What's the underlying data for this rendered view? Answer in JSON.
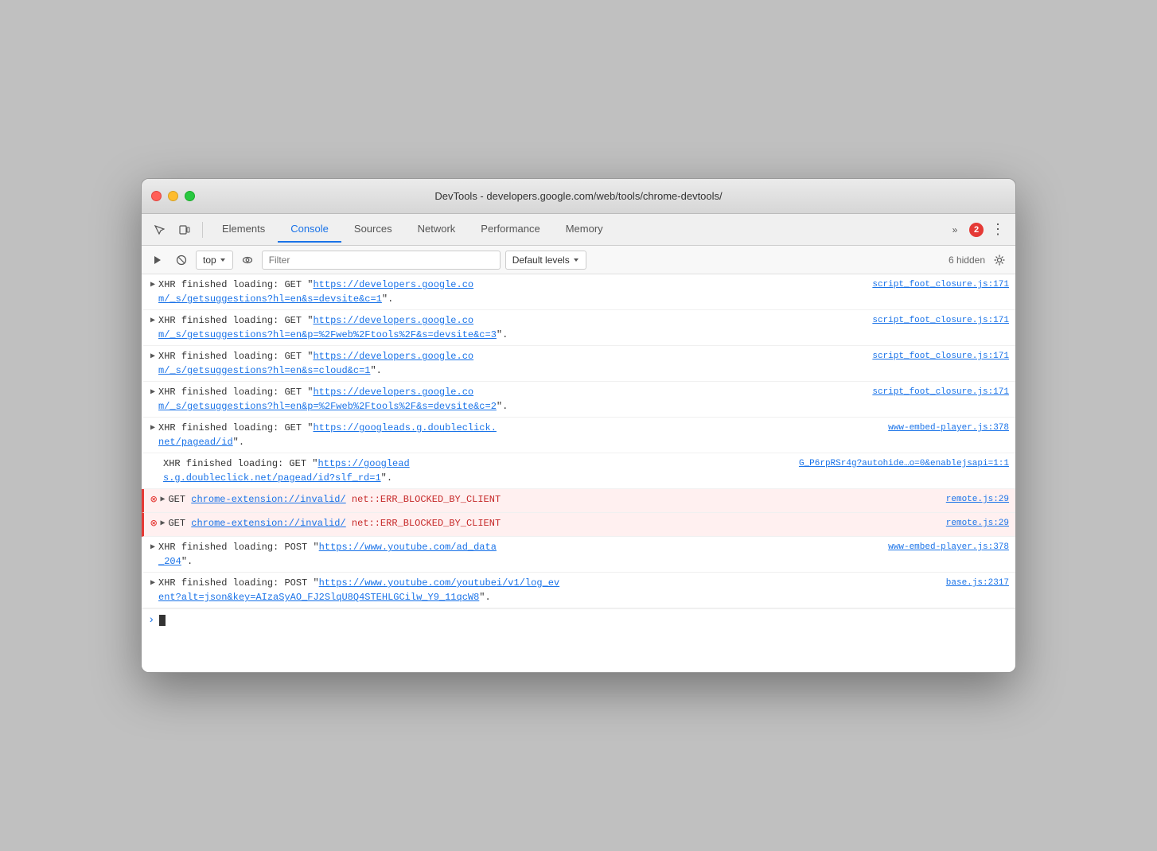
{
  "window": {
    "title": "DevTools - developers.google.com/web/tools/chrome-devtools/"
  },
  "toolbar": {
    "tabs": [
      {
        "id": "elements",
        "label": "Elements",
        "active": false
      },
      {
        "id": "console",
        "label": "Console",
        "active": true
      },
      {
        "id": "sources",
        "label": "Sources",
        "active": false
      },
      {
        "id": "network",
        "label": "Network",
        "active": false
      },
      {
        "id": "performance",
        "label": "Performance",
        "active": false
      },
      {
        "id": "memory",
        "label": "Memory",
        "active": false
      }
    ],
    "error_count": "2",
    "more_label": "»"
  },
  "console_toolbar": {
    "context": "top",
    "filter_placeholder": "Filter",
    "levels_label": "Default levels",
    "hidden_count": "6 hidden"
  },
  "entries": [
    {
      "type": "normal",
      "has_expand": true,
      "text": "XHR finished loading: GET \"https://developers.google.co\nm/_s/getsuggestions?hl=en&s=devsite&c=1\".",
      "source": "script_foot_closure.js:171"
    },
    {
      "type": "normal",
      "has_expand": true,
      "text": "XHR finished loading: GET \"https://developers.google.co\nm/_s/getsuggestions?hl=en&p=%2Fweb%2Ftools%2F&s=devsite&c=3\".",
      "source": "script_foot_closure.js:171"
    },
    {
      "type": "normal",
      "has_expand": true,
      "text": "XHR finished loading: GET \"https://developers.google.co\nm/_s/getsuggestions?hl=en&s=cloud&c=1\".",
      "source": "script_foot_closure.js:171"
    },
    {
      "type": "normal",
      "has_expand": true,
      "text": "XHR finished loading: GET \"https://developers.google.co\nm/_s/getsuggestions?hl=en&p=%2Fweb%2Ftools%2F&s=devsite&c=2\".",
      "source": "script_foot_closure.js:171"
    },
    {
      "type": "normal",
      "has_expand": true,
      "text": "XHR finished loading: GET \"https://googleads.g.doubleclick.\nnet/pagead/id\".",
      "source": "www-embed-player.js:378"
    },
    {
      "type": "normal",
      "has_expand": false,
      "text": "XHR finished loading: GET \"https://googlead\ns.g.doubleclick.net/pagead/id?slf_rd=1\".",
      "source": "G_P6rpRSr4g?autohide…o=0&enablejsapi=1:1"
    },
    {
      "type": "error",
      "has_expand": true,
      "text_prefix": "GET chrome-extension://invalid/",
      "text_error": " net::ERR_BLOCKED_BY_CLIENT",
      "source": "remote.js:29"
    },
    {
      "type": "error",
      "has_expand": true,
      "text_prefix": "GET chrome-extension://invalid/",
      "text_error": " net::ERR_BLOCKED_BY_CLIENT",
      "source": "remote.js:29"
    },
    {
      "type": "normal",
      "has_expand": true,
      "text": "XHR finished loading: POST \"https://www.youtube.com/ad_data\n_204\".",
      "source": "www-embed-player.js:378"
    },
    {
      "type": "normal",
      "has_expand": true,
      "text": "XHR finished loading: POST \"https://www.youtube.com/youtubei/v1/log_ev\nent?alt=json&key=AIzaSyAO_FJ2SlqU8Q4STEHLGCilw_Y9_11qcW8\".",
      "source": "base.js:2317"
    }
  ]
}
